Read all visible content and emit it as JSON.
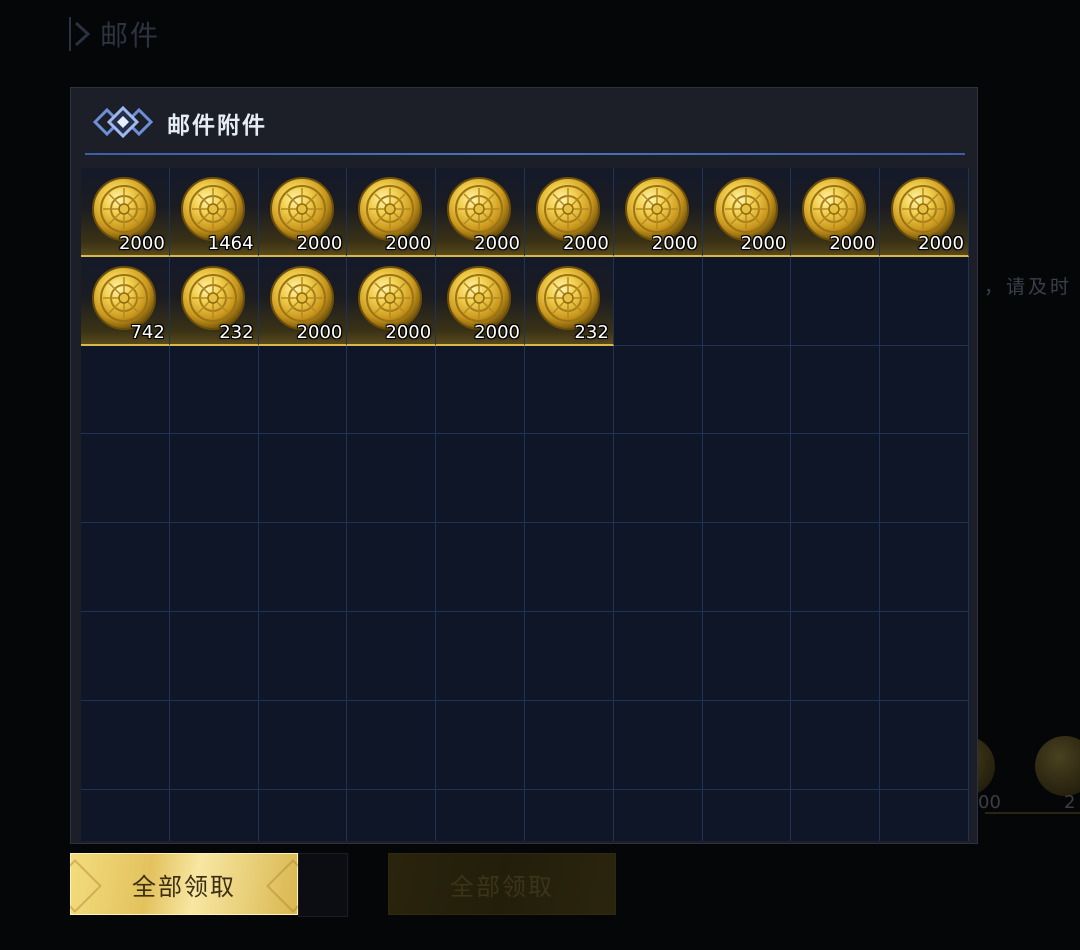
{
  "background": {
    "page_title": "邮件",
    "notice_fragment": "，请及时",
    "partial_quantities": [
      "00",
      "2"
    ]
  },
  "dialog": {
    "title": "邮件附件",
    "icon": "diamond-emblem-icon",
    "grid_columns": 10,
    "total_slots": 80,
    "item_icon": "gold-coin-icon",
    "items": [
      {
        "quantity": "2000"
      },
      {
        "quantity": "1464"
      },
      {
        "quantity": "2000"
      },
      {
        "quantity": "2000"
      },
      {
        "quantity": "2000"
      },
      {
        "quantity": "2000"
      },
      {
        "quantity": "2000"
      },
      {
        "quantity": "2000"
      },
      {
        "quantity": "2000"
      },
      {
        "quantity": "2000"
      },
      {
        "quantity": "742"
      },
      {
        "quantity": "232"
      },
      {
        "quantity": "2000"
      },
      {
        "quantity": "2000"
      },
      {
        "quantity": "2000"
      },
      {
        "quantity": "232"
      }
    ]
  },
  "buttons": {
    "claim_all_label": "全部领取",
    "claim_all_dim_label": "全部领取"
  },
  "colors": {
    "accent_gold": "#d9b948",
    "divider_blue": "#4c72bd",
    "dialog_bg": "#1c1f28",
    "slot_bg": "#0f1628"
  }
}
